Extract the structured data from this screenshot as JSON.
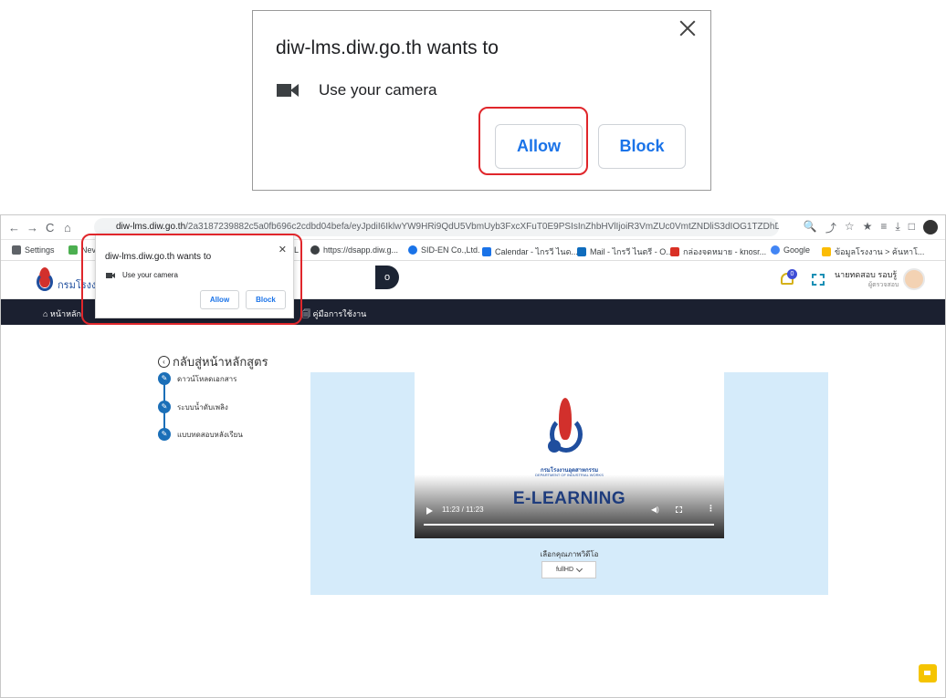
{
  "permission_prompt": {
    "title": "diw-lms.diw.go.th wants to",
    "camera_text": "Use your camera",
    "allow_label": "Allow",
    "block_label": "Block",
    "close_symbol": "✕",
    "camera_icon": "camera-icon",
    "highlight_color": "#e0262b"
  },
  "browser": {
    "back": "←",
    "forward": "→",
    "reload": "C",
    "home": "⌂",
    "url_host": "diw-lms.diw.go.th",
    "url_rest": "/2a3187239882c5a0fb696c2cdbd04befa/eyJpdiI6IklwYW9HRi9QdU5VbmUyb3FxcXFuT0E9PSIsInZhbHVlIjoiR3VmZUc0VmtZNDliS3dIOG1TZDhDZz09Iiwi...",
    "tools": [
      "🔍",
      "⤴",
      "☆",
      "★",
      "≡",
      "⤓",
      "□"
    ],
    "bookmarks": [
      {
        "label": "Settings",
        "color": "#5f6368"
      },
      {
        "label": "Nev",
        "color": "#4caf50"
      },
      {
        "label": "L",
        "color": "#5f6368"
      },
      {
        "label": "https://dsapp.diw.g...",
        "color": "#3c4043"
      },
      {
        "label": "SID-EN Co.,Ltd.",
        "color": "#1a73e8"
      },
      {
        "label": "Calendar - ไกรวี ไนด...",
        "color": "#1a73e8"
      },
      {
        "label": "Mail - ไกรวี ไนตรี - O...",
        "color": "#0f6cbd"
      },
      {
        "label": "กล่องจดหมาย - knosr...",
        "color": "#d93025"
      },
      {
        "label": "Google",
        "color": "#4285f4"
      },
      {
        "label": "ข้อมูลโรงงาน > ค้นหาโ...",
        "color": "#fbbc04"
      }
    ]
  },
  "site": {
    "logo_text": "กรมโรงงา",
    "search_button": "o",
    "notification_count": "0",
    "user_name": "นายทดสอบ รอบรู้",
    "user_role": "ผู้ตรวจสอบ",
    "nav": {
      "home": "⌂ หน้าหลัก",
      "manual": "🗐 คู่มือการใช้งาน"
    },
    "course": {
      "back_label": "กลับสู่หน้าหลักสูตร",
      "back_icon": "‹",
      "steps": [
        {
          "label": "ดาวน์โหลดเอกสาร"
        },
        {
          "label": "ระบบน้ำดับเพลิง"
        },
        {
          "label": "แบบทดสอบหลังเรียน"
        }
      ]
    },
    "video": {
      "dept_th": "กรมโรงงานอุตสาหกรรม",
      "dept_en": "DEPARTMENT OF INDUSTRIAL WORKS",
      "title": "E-LEARNING",
      "time": "11:23 / 11:23",
      "progress": 1.0,
      "volume_icon": "◀)",
      "more_icon": "⋮"
    },
    "quality": {
      "label": "เลือกคุณภาพวิดีโอ",
      "selected": "fullHD"
    },
    "colors": {
      "navbar": "#1b2030",
      "video_panel": "#d5ebfa",
      "step_blue": "#1b6fb8",
      "chat_fab": "#f5c400"
    }
  }
}
